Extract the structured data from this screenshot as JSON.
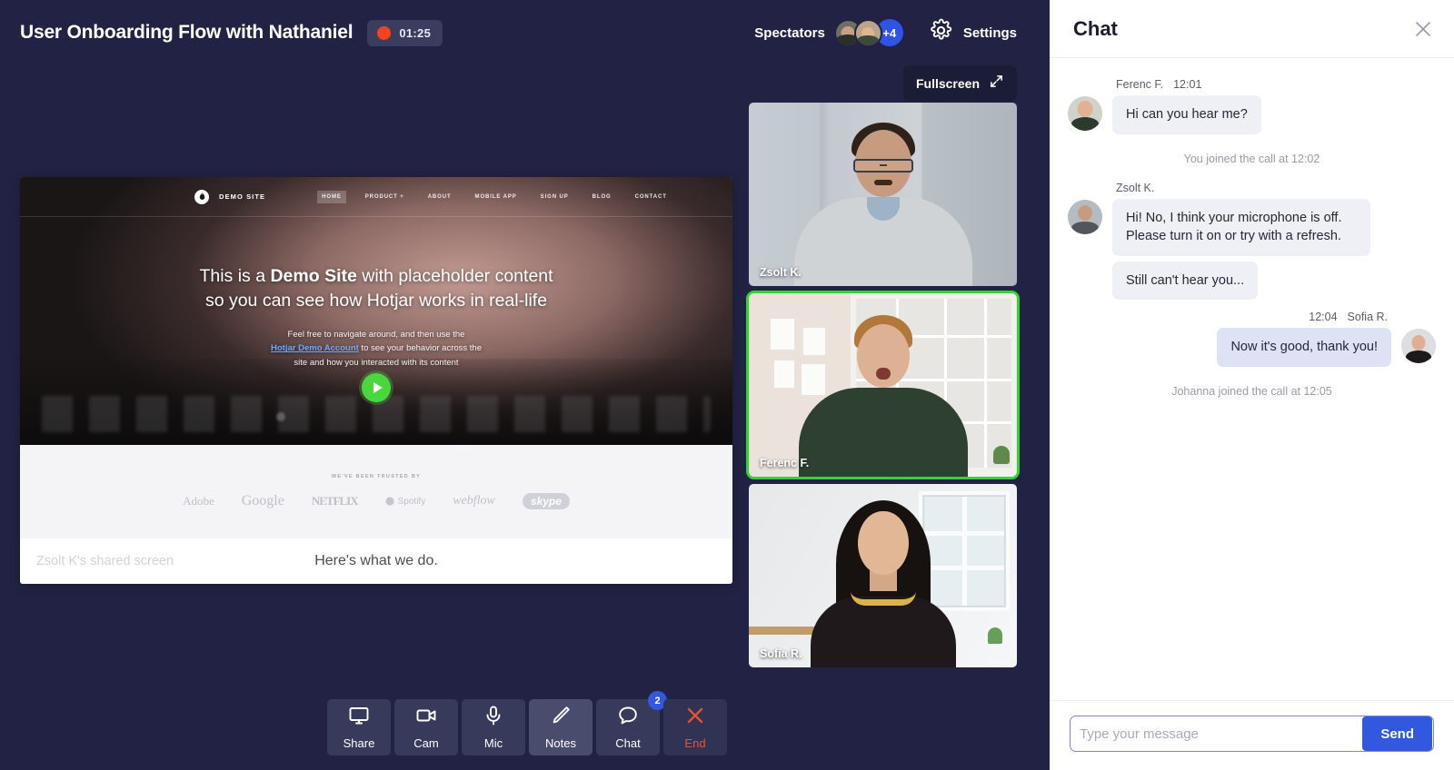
{
  "header": {
    "call_title": "User Onboarding Flow with Nathaniel",
    "recording_time": "01:25",
    "spectators_label": "Spectators",
    "spectators_overflow": "+4",
    "settings_label": "Settings"
  },
  "stage": {
    "fullscreen_label": "Fullscreen",
    "share_caption": "Zsolt K's shared screen"
  },
  "shared_screen": {
    "brand": "DEMO SITE",
    "nav": [
      "HOME",
      "PRODUCT +",
      "ABOUT",
      "MOBILE APP",
      "SIGN UP",
      "BLOG",
      "CONTACT"
    ],
    "headline_pre": "This is a ",
    "headline_bold": "Demo Site",
    "headline_post": " with placeholder content",
    "headline_line2": "so you can see how Hotjar works in real-life",
    "sub_line1": "Feel free to navigate around, and then use the",
    "sub_link": "Hotjar Demo Account",
    "sub_line2_rest": " to see your behavior across the",
    "sub_line3": "site and how you interacted with its content",
    "trusted_label": "WE'VE BEEN TRUSTED BY",
    "trusted_logos": [
      "Adobe",
      "Google",
      "NETFLIX",
      "Spotify",
      "webflow",
      "skype"
    ],
    "footer_text": "Here's what we do."
  },
  "tiles": [
    {
      "name": "Zsolt K.",
      "active": false
    },
    {
      "name": "Ferenc F.",
      "active": true
    },
    {
      "name": "Sofia R.",
      "active": false
    }
  ],
  "controls": [
    {
      "label": "Share",
      "icon": "monitor-icon",
      "state": "default",
      "badge": null
    },
    {
      "label": "Cam",
      "icon": "camera-icon",
      "state": "default",
      "badge": null
    },
    {
      "label": "Mic",
      "icon": "microphone-icon",
      "state": "default",
      "badge": null
    },
    {
      "label": "Notes",
      "icon": "pencil-icon",
      "state": "active",
      "badge": null
    },
    {
      "label": "Chat",
      "icon": "speech-bubble-icon",
      "state": "default",
      "badge": "2"
    },
    {
      "label": "End",
      "icon": "close-x-icon",
      "state": "danger",
      "badge": null
    }
  ],
  "chat": {
    "title": "Chat",
    "messages": [
      {
        "kind": "message",
        "side": "left",
        "author": "Ferenc F.",
        "time": "12:01",
        "lines": [
          "Hi can you hear me?"
        ]
      },
      {
        "kind": "system",
        "text": "You joined the call at 12:02"
      },
      {
        "kind": "message",
        "side": "left",
        "author": "Zsolt K.",
        "time": "",
        "lines": [
          "Hi! No, I think your microphone is off. Please turn it on or try with a refresh.",
          "Still can't hear you..."
        ]
      },
      {
        "kind": "message",
        "side": "right",
        "author": "Sofia R.",
        "time": "12:04",
        "lines": [
          "Now it's good, thank you!"
        ]
      },
      {
        "kind": "system",
        "text": "Johanna joined the call at 12:05"
      }
    ],
    "input_placeholder": "Type your message",
    "input_value": "",
    "send_label": "Send"
  },
  "colors": {
    "background": "#222344",
    "accent_blue": "#3358e0",
    "active_speaker_green": "#2fd62f",
    "recording_red": "#f6431b",
    "end_red": "#f0502a",
    "play_green": "#4ad63d"
  }
}
